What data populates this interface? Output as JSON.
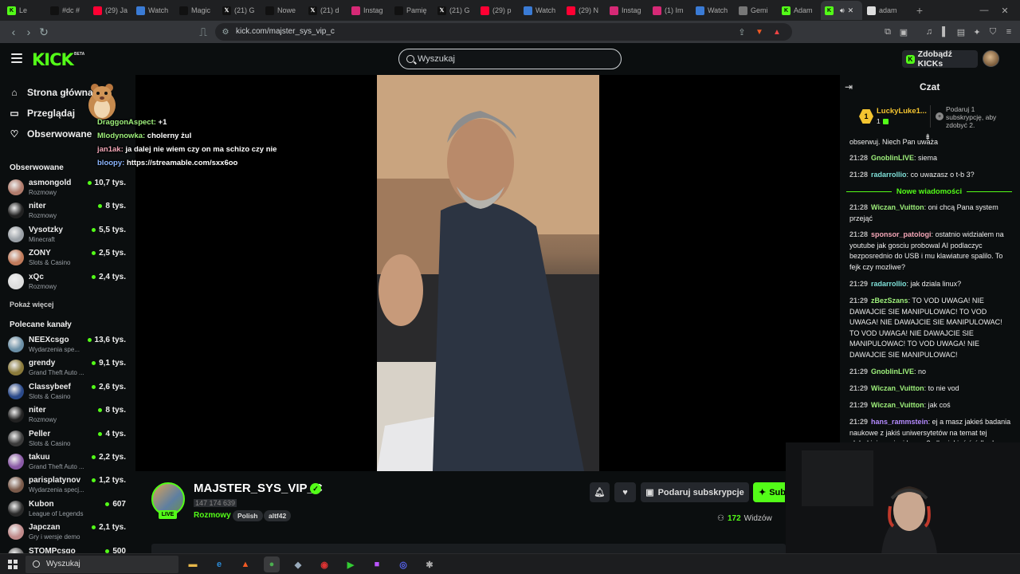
{
  "browser": {
    "tabs": [
      {
        "label": "Le",
        "fav": "kick",
        "color": "#53fc18"
      },
      {
        "label": "#dc #",
        "fav": "tiktok",
        "color": "#111111"
      },
      {
        "label": "(29) Ja",
        "fav": "youtube",
        "color": "#ff0033"
      },
      {
        "label": "Watch",
        "fav": "watch",
        "color": "#3a7bd5"
      },
      {
        "label": "Magic",
        "fav": "tiktok",
        "color": "#111111"
      },
      {
        "label": "(21) G",
        "fav": "x",
        "color": "#111111"
      },
      {
        "label": "Nowe",
        "fav": "tiktok",
        "color": "#111111"
      },
      {
        "label": "(21) d",
        "fav": "x",
        "color": "#111111"
      },
      {
        "label": "Instag",
        "fav": "instagram",
        "color": "#d62976"
      },
      {
        "label": "Pamię",
        "fav": "tiktok",
        "color": "#111111"
      },
      {
        "label": "(21) G",
        "fav": "x",
        "color": "#111111"
      },
      {
        "label": "(29) p",
        "fav": "youtube",
        "color": "#ff0033"
      },
      {
        "label": "Watch",
        "fav": "watch",
        "color": "#3a7bd5"
      },
      {
        "label": "(29) N",
        "fav": "youtube",
        "color": "#ff0033"
      },
      {
        "label": "Instag",
        "fav": "instagram",
        "color": "#d62976"
      },
      {
        "label": "(1) Im",
        "fav": "instagram",
        "color": "#d62976"
      },
      {
        "label": "Watch",
        "fav": "watch",
        "color": "#3a7bd5"
      },
      {
        "label": "Gemi",
        "fav": "gemini",
        "color": "#777777"
      },
      {
        "label": "Adam",
        "fav": "kick",
        "color": "#53fc18"
      },
      {
        "label": "",
        "fav": "kick",
        "color": "#53fc18",
        "active": true
      },
      {
        "label": "adam",
        "fav": "generic",
        "color": "#dddddd"
      }
    ],
    "url": "kick.com/majster_sys_vip_c"
  },
  "header": {
    "logo": "KICK",
    "logo_badge": "BETA",
    "search_placeholder": "Wyszukaj",
    "kicks_button": "Zdobądź KICKs"
  },
  "sidebar": {
    "nav": [
      {
        "label": "Strona główna",
        "icon": "home-icon"
      },
      {
        "label": "Przeglądaj",
        "icon": "browse-icon"
      },
      {
        "label": "Obserwowane",
        "icon": "heart-icon"
      }
    ],
    "followed_title": "Obserwowane",
    "followed": [
      {
        "name": "asmongold",
        "category": "Rozmowy",
        "viewers": "10,7 tys.",
        "color": "#b07b6b"
      },
      {
        "name": "niter",
        "category": "Rozmowy",
        "viewers": "8 tys.",
        "color": "#222222"
      },
      {
        "name": "Vysotzky",
        "category": "Minecraft",
        "viewers": "5,5 tys.",
        "color": "#9aa0a6"
      },
      {
        "name": "ZONY",
        "category": "Slots & Casino",
        "viewers": "2,5 tys.",
        "color": "#c07a5a"
      },
      {
        "name": "xQc",
        "category": "Rozmowy",
        "viewers": "2,4 tys.",
        "color": "#dddddd"
      }
    ],
    "show_more": "Pokaż więcej",
    "recommended_title": "Polecane kanały",
    "recommended": [
      {
        "name": "NEEXcsgo",
        "category": "Wydarzenia spe...",
        "viewers": "13,6 tys.",
        "color": "#6b8fa6"
      },
      {
        "name": "grendy",
        "category": "Grand Theft Auto ...",
        "viewers": "9,1 tys.",
        "color": "#8a7a3a"
      },
      {
        "name": "Classybeef",
        "category": "Slots & Casino",
        "viewers": "2,6 tys.",
        "color": "#2b4a8a"
      },
      {
        "name": "niter",
        "category": "Rozmowy",
        "viewers": "8 tys.",
        "color": "#222222"
      },
      {
        "name": "Peller",
        "category": "Slots & Casino",
        "viewers": "4 tys.",
        "color": "#3a3a3a"
      },
      {
        "name": "takuu",
        "category": "Grand Theft Auto ...",
        "viewers": "2,2 tys.",
        "color": "#8a5aa6"
      },
      {
        "name": "parisplatynov",
        "category": "Wydarzenia specj...",
        "viewers": "1,2 tys.",
        "color": "#7a5a4a"
      },
      {
        "name": "Kubon",
        "category": "League of Legends",
        "viewers": "607",
        "color": "#2a2a2a"
      },
      {
        "name": "Japczan",
        "category": "Gry i wersje demo",
        "viewers": "2,1 tys.",
        "color": "#c08a8a"
      },
      {
        "name": "STOMPcsgo",
        "category": "",
        "viewers": "500",
        "color": "#6a6a6a"
      }
    ]
  },
  "overlay_chat": [
    {
      "user": "DraggonAspect:",
      "text": " +1",
      "color": "green",
      "prefix": ""
    },
    {
      "user": "Mlodynowka:",
      "text": " cholerny żul",
      "color": "green",
      "prefix": ""
    },
    {
      "user": "jan1ak:",
      "text": " ja dalej nie wiem czy on ma schizo czy nie",
      "color": "pink",
      "prefix": ""
    },
    {
      "user": "bloopy:",
      "text": " https://streamable.com/sxx6oo",
      "color": "blue",
      "prefix": ""
    }
  ],
  "stream": {
    "name": "MAJSTER_SYS_VIP_C",
    "followers": "147 174 639",
    "live": "LIVE",
    "category": "Rozmowy",
    "tags": [
      "Polish",
      "altf42"
    ],
    "gift_sub_label": "Podaruj subskrypcje",
    "subscribe_label": "Subskrybuj",
    "viewers_count": "172",
    "viewers_label": "Widzów"
  },
  "chat": {
    "title": "Czat",
    "top_gifter": "LuckyLuke1...",
    "top_gifter_rank": "1",
    "top_gifter_count": "1",
    "gift_info": "Podaruj 1 subskrypcję, aby zdobyć 2.",
    "cut_text": "obserwuj. Niech Pan uważa",
    "new_messages_label": "Nowe wiadomości",
    "messages": [
      {
        "time": "21:28",
        "user": "GnoblinLIVE",
        "text": "siema",
        "color": "green"
      },
      {
        "time": "21:28",
        "user": "radarrollio",
        "text": "co uwazasz o t-b 3?",
        "color": "blue"
      },
      {
        "time": "21:28",
        "user": "Wiczan_Vuitton",
        "text": "oni chcą Pana system przejąć",
        "color": "green"
      },
      {
        "time": "21:28",
        "user": "sponsor_patologi",
        "text": "ostatnio widzialem na youtube jak gosciu probowal AI podlaczyc bezposrednio do USB i mu klawiature spalilo. To fejk czy mozliwe?",
        "color": "pink"
      },
      {
        "time": "21:29",
        "user": "radarrollio",
        "text": "jak dziala linux?",
        "color": "blue"
      },
      {
        "time": "21:29",
        "user": "zBezSzans",
        "text": "TO VOD UWAGA! NIE DAWAJCIE SIE MANIPULOWAC! TO VOD UWAGA! NIE DAWAJCIE SIE MANIPULOWAC! TO VOD UWAGA! NIE DAWAJCIE SIE MANIPULOWAC! TO VOD UWAGA! NIE DAWAJCIE SIE MANIPULOWAC!",
        "color": "green"
      },
      {
        "time": "21:29",
        "user": "GnoblinLIVE",
        "text": "no",
        "color": "green"
      },
      {
        "time": "21:29",
        "user": "Wiczan_Vuitton",
        "text": "to nie vod",
        "color": "green"
      },
      {
        "time": "21:29",
        "user": "Wiczan_Vuitton",
        "text": "jak coś",
        "color": "green"
      },
      {
        "time": "21:29",
        "user": "hans_rammstein",
        "text": "ej a masz jakieś badania naukowe z jakiś uniwersytetów na temat tej głębokiej pamięci kramu? albo jakieś źródło do",
        "color": "purple"
      }
    ]
  },
  "taskbar": {
    "search_label": "Wyszukaj",
    "apps": [
      {
        "name": "file-explorer-icon",
        "color": "#e8b84a",
        "glyph": "▬",
        "running": false
      },
      {
        "name": "edge-icon",
        "color": "#2b8ad6",
        "glyph": "e",
        "running": false
      },
      {
        "name": "brave-icon",
        "color": "#f25a24",
        "glyph": "▲",
        "running": false
      },
      {
        "name": "chrome-icon",
        "color": "#4caf50",
        "glyph": "●",
        "running": true
      },
      {
        "name": "app-icon",
        "color": "#9ab",
        "glyph": "◆",
        "running": false
      },
      {
        "name": "capture-icon",
        "color": "#d33",
        "glyph": "◉",
        "running": false
      },
      {
        "name": "play-icon",
        "color": "#3c3",
        "glyph": "▶",
        "running": false
      },
      {
        "name": "stream-app-icon",
        "color": "#b5f",
        "glyph": "■",
        "running": false
      },
      {
        "name": "discord-icon",
        "color": "#5865f2",
        "glyph": "◎",
        "running": false
      },
      {
        "name": "tool-icon",
        "color": "#aaa",
        "glyph": "✱",
        "running": false
      }
    ]
  }
}
